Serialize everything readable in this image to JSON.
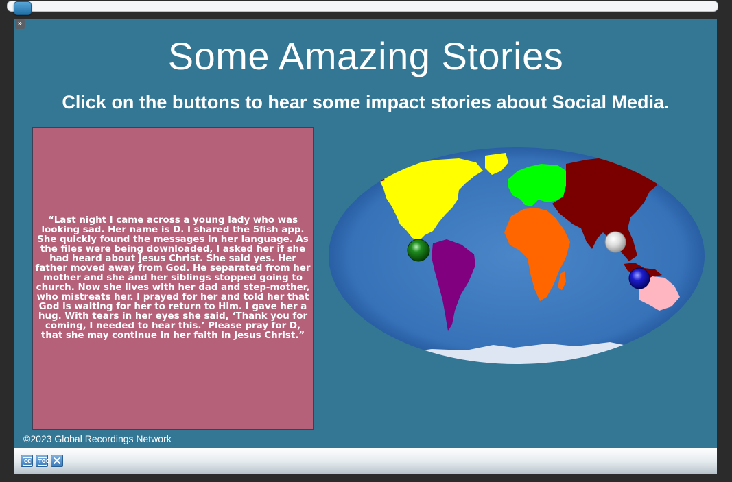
{
  "title": "Some Amazing Stories",
  "subtitle": "Click on the buttons to hear some impact stories about Social Media.",
  "story": "“Last night I came across a young lady who was looking sad. Her name is D. I shared the 5fish app. She quickly found the messages in her language. As the files were being downloaded, I asked her if she had heard about Jesus Christ. She said yes. Her father moved away from God. He separated from her mother and she and her siblings stopped going to church. Now she lives with her dad and step-mother, who mistreats her. I prayed for her and told her that God is waiting for her to return to Him. I gave her a hug. With tears in her eyes she said, ‘Thank you for coming, I needed to hear this.’ Please pray for D, that she may continue in her faith in Jesus Christ.”",
  "copyright": "©2023 Global Recordings Network",
  "controls": {
    "cc_label": "CC",
    "toc_label": "TOC",
    "sidebar_toggle": "»",
    "close_icon": "close-icon"
  },
  "map": {
    "colors": {
      "north_america": "#ffff00",
      "south_america": "#800080",
      "europe": "#00ff00",
      "africa": "#ff6600",
      "asia": "#7a0000",
      "australia": "#ffb6c1",
      "antarctica": "#dfe6f3",
      "ocean": "#3f7cc0"
    },
    "story_buttons": [
      {
        "name": "green-story-button",
        "color": "#0a6a0a"
      },
      {
        "name": "white-story-button",
        "color": "#d8d8d8"
      },
      {
        "name": "blue-story-button",
        "color": "#1a1ac8"
      }
    ]
  },
  "progress": 0.01
}
